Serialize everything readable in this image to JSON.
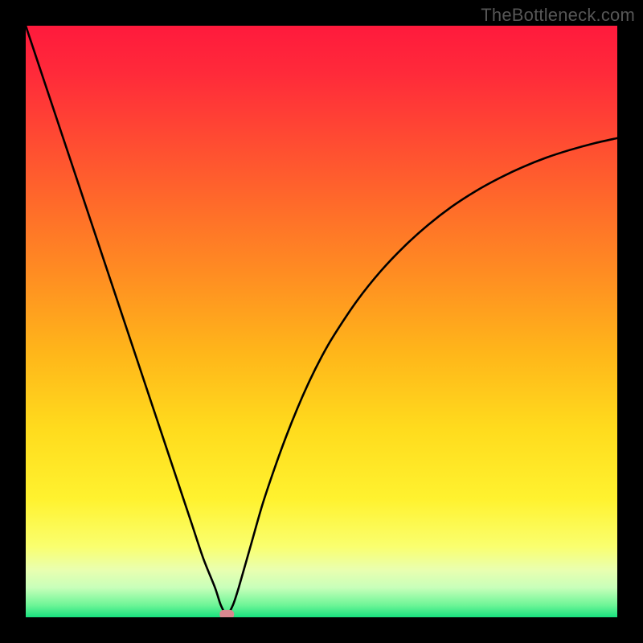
{
  "watermark": "TheBottleneck.com",
  "colors": {
    "background_black": "#000000",
    "curve_stroke": "#000000",
    "marker_fill": "#d9888f",
    "gradient_stops": [
      {
        "offset": 0.0,
        "color": "#ff1a3c"
      },
      {
        "offset": 0.08,
        "color": "#ff2a3a"
      },
      {
        "offset": 0.18,
        "color": "#ff4733"
      },
      {
        "offset": 0.3,
        "color": "#ff6a2a"
      },
      {
        "offset": 0.42,
        "color": "#ff8d22"
      },
      {
        "offset": 0.55,
        "color": "#ffb51a"
      },
      {
        "offset": 0.68,
        "color": "#ffdb1d"
      },
      {
        "offset": 0.8,
        "color": "#fff22f"
      },
      {
        "offset": 0.88,
        "color": "#faff6e"
      },
      {
        "offset": 0.92,
        "color": "#e9ffb0"
      },
      {
        "offset": 0.95,
        "color": "#c8ffba"
      },
      {
        "offset": 0.98,
        "color": "#6cf596"
      },
      {
        "offset": 1.0,
        "color": "#18e17f"
      }
    ]
  },
  "chart_data": {
    "type": "line",
    "title": "",
    "xlabel": "",
    "ylabel": "",
    "xlim": [
      0,
      100
    ],
    "ylim": [
      0,
      100
    ],
    "grid": false,
    "x": [
      0,
      2,
      4,
      6,
      8,
      10,
      12,
      14,
      16,
      18,
      20,
      22,
      24,
      26,
      28,
      30,
      32,
      33,
      34,
      35,
      36,
      38,
      40,
      42,
      44,
      46,
      48,
      50,
      52,
      56,
      60,
      64,
      68,
      72,
      76,
      80,
      84,
      88,
      92,
      96,
      100
    ],
    "values": [
      100,
      94,
      88,
      82,
      76,
      70,
      64,
      58,
      52,
      46,
      40,
      34,
      28,
      22,
      16,
      10,
      5,
      2,
      0.5,
      2,
      5,
      12,
      19,
      25,
      30.5,
      35.5,
      40,
      44,
      47.5,
      53.5,
      58.5,
      62.7,
      66.3,
      69.4,
      72.0,
      74.2,
      76.1,
      77.7,
      79.0,
      80.1,
      81.0
    ],
    "marker": {
      "x": 34,
      "y": 0.5,
      "shape": "rounded-rect"
    }
  }
}
